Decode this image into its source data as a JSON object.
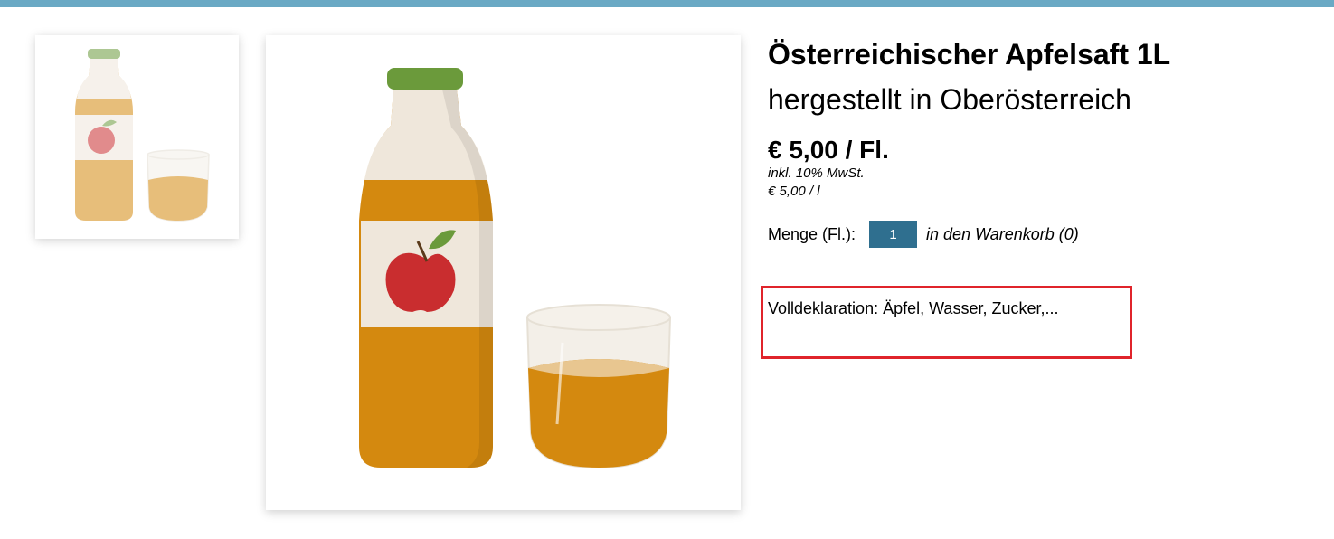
{
  "product": {
    "title": "Österreichischer Apfelsaft 1L",
    "subtitle": "hergestellt in Oberösterreich",
    "price": "€ 5,00 / Fl.",
    "tax_note": "inkl. 10% MwSt.",
    "unit_price": "€ 5,00 / l",
    "quantity_label": "Menge (Fl.):",
    "quantity_value": "1",
    "add_to_cart_label": "in den Warenkorb (0)",
    "declaration": "Volldeklaration: Äpfel, Wasser, Zucker,..."
  },
  "images": {
    "thumbnail_icon": "juice-bottle-glass-icon",
    "main_icon": "juice-bottle-glass-icon"
  },
  "colors": {
    "top_bar": "#6aa9c4",
    "juice": "#d4890f",
    "cap": "#6b9a3b",
    "quantity_input": "#2f6f8f",
    "highlight_box": "#e0242b"
  }
}
